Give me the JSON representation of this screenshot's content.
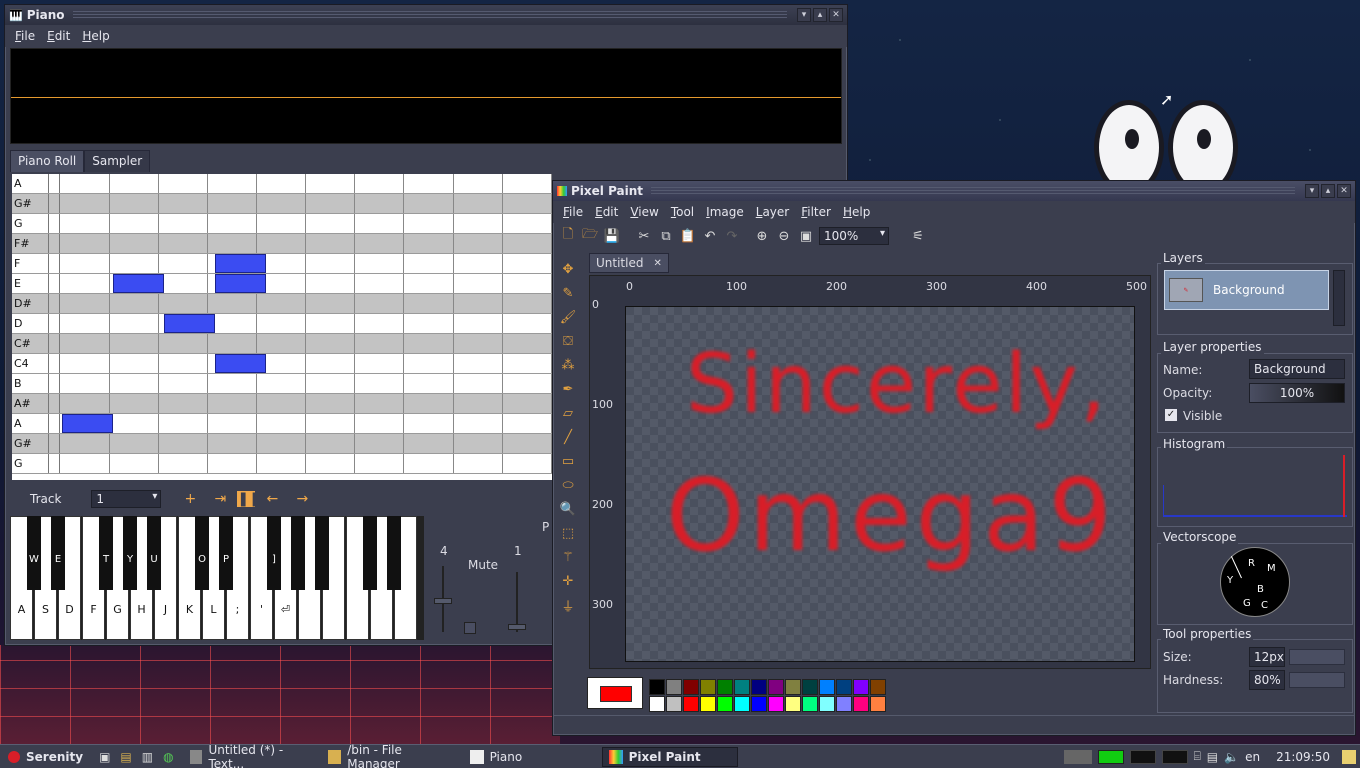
{
  "piano": {
    "title": "Piano",
    "menu": [
      "File",
      "Edit",
      "Help"
    ],
    "tabs": [
      "Piano Roll",
      "Sampler"
    ],
    "roll_notes": [
      "A",
      "G#",
      "G",
      "F#",
      "F",
      "E",
      "D#",
      "D",
      "C#",
      "C4",
      "B",
      "A#",
      "A",
      "G#",
      "G"
    ],
    "track_label": "Track",
    "track_value": "1",
    "white_keys": [
      "A",
      "S",
      "D",
      "F",
      "G",
      "H",
      "J",
      "K",
      "L",
      ";",
      "'",
      "⏎"
    ],
    "black_keys": [
      "W",
      "E",
      "T",
      "Y",
      "U",
      "O",
      "P",
      "]"
    ],
    "mixer": {
      "octave": "4",
      "mute_label": "Mute",
      "volume": "1",
      "panel_label": "P"
    }
  },
  "paint": {
    "title": "Pixel Paint",
    "menu": [
      "File",
      "Edit",
      "View",
      "Tool",
      "Image",
      "Layer",
      "Filter",
      "Help"
    ],
    "zoom": "100%",
    "doc_tab": "Untitled",
    "ruler_x": [
      "0",
      "100",
      "200",
      "300",
      "400",
      "500"
    ],
    "ruler_y": [
      "0",
      "100",
      "200",
      "300"
    ],
    "canvas_text": [
      "Sincerely,",
      "Omega9"
    ],
    "layers": {
      "title": "Layers",
      "items": [
        "Background"
      ]
    },
    "layer_props": {
      "title": "Layer properties",
      "name_label": "Name:",
      "name_value": "Background",
      "opacity_label": "Opacity:",
      "opacity_value": "100%",
      "visible_label": "Visible"
    },
    "histogram_title": "Histogram",
    "vectorscope": {
      "title": "Vectorscope",
      "labels": [
        "R",
        "M",
        "Y",
        "B",
        "G",
        "C"
      ]
    },
    "tool_props": {
      "title": "Tool properties",
      "size_label": "Size:",
      "size_value": "12px",
      "hardness_label": "Hardness:",
      "hardness_value": "80%"
    },
    "primary_color": "#ff0000",
    "palette_top": [
      "#000000",
      "#808080",
      "#800000",
      "#808000",
      "#008000",
      "#008080",
      "#000080",
      "#800080",
      "#808040",
      "#004040",
      "#0080ff",
      "#004080",
      "#8000ff",
      "#804000"
    ],
    "palette_bottom": [
      "#ffffff",
      "#c0c0c0",
      "#ff0000",
      "#ffff00",
      "#00ff00",
      "#00ffff",
      "#0000ff",
      "#ff00ff",
      "#ffff80",
      "#00ff80",
      "#80ffff",
      "#8080ff",
      "#ff0080",
      "#ff8040"
    ]
  },
  "taskbar": {
    "start": "Serenity",
    "tasks": [
      "Untitled (*) - Text...",
      "/bin - File Manager",
      "Piano",
      "Pixel Paint"
    ],
    "keymap": "en",
    "clock": "21:09:50"
  }
}
